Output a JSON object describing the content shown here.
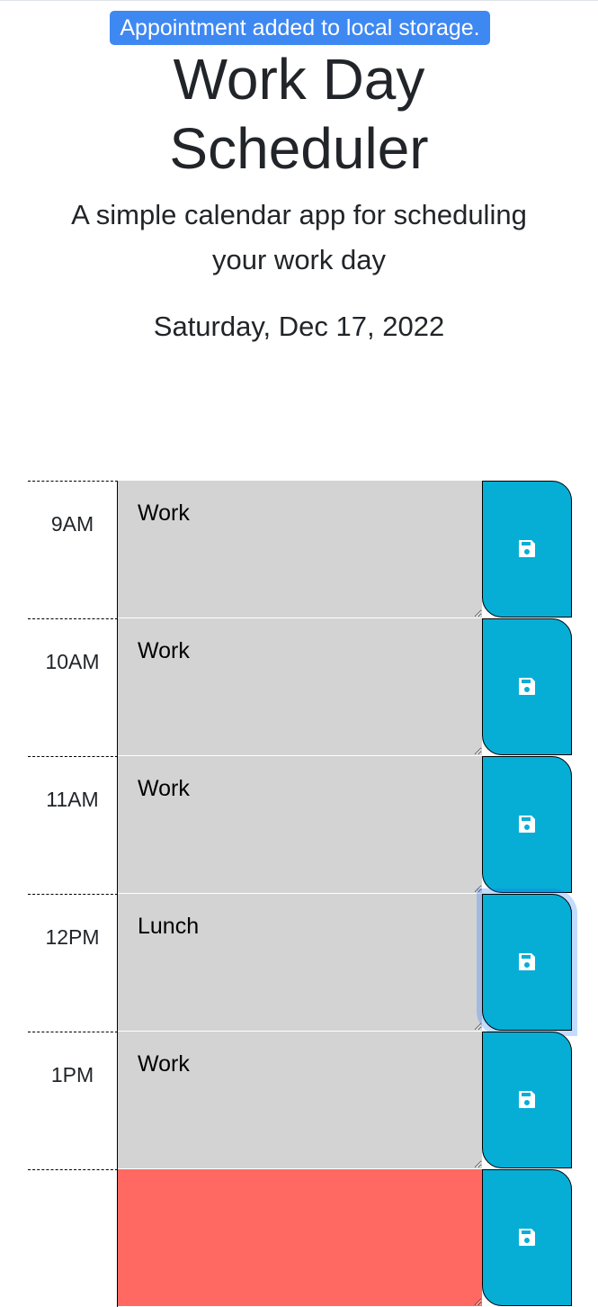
{
  "notice": {
    "text": "Appointment added to local storage."
  },
  "header": {
    "title_line1": "Work Day",
    "title_line2": "Scheduler",
    "lead_line1": "A simple calendar app for scheduling",
    "lead_line2": "your work day",
    "date": "Saturday, Dec 17, 2022"
  },
  "schedule": {
    "rows": [
      {
        "hour": "9AM",
        "text": "Work",
        "state": "past"
      },
      {
        "hour": "10AM",
        "text": "Work",
        "state": "past"
      },
      {
        "hour": "11AM",
        "text": "Work",
        "state": "past"
      },
      {
        "hour": "12PM",
        "text": "Lunch",
        "state": "past"
      },
      {
        "hour": "1PM",
        "text": "Work",
        "state": "past"
      },
      {
        "hour": "",
        "text": "",
        "state": "present"
      }
    ],
    "save_icon": "floppy-disk-icon"
  },
  "colors": {
    "notice_bg": "#3e88f2",
    "past": "#d3d3d3",
    "present": "#ff6961",
    "save_button": "#06aed5"
  }
}
